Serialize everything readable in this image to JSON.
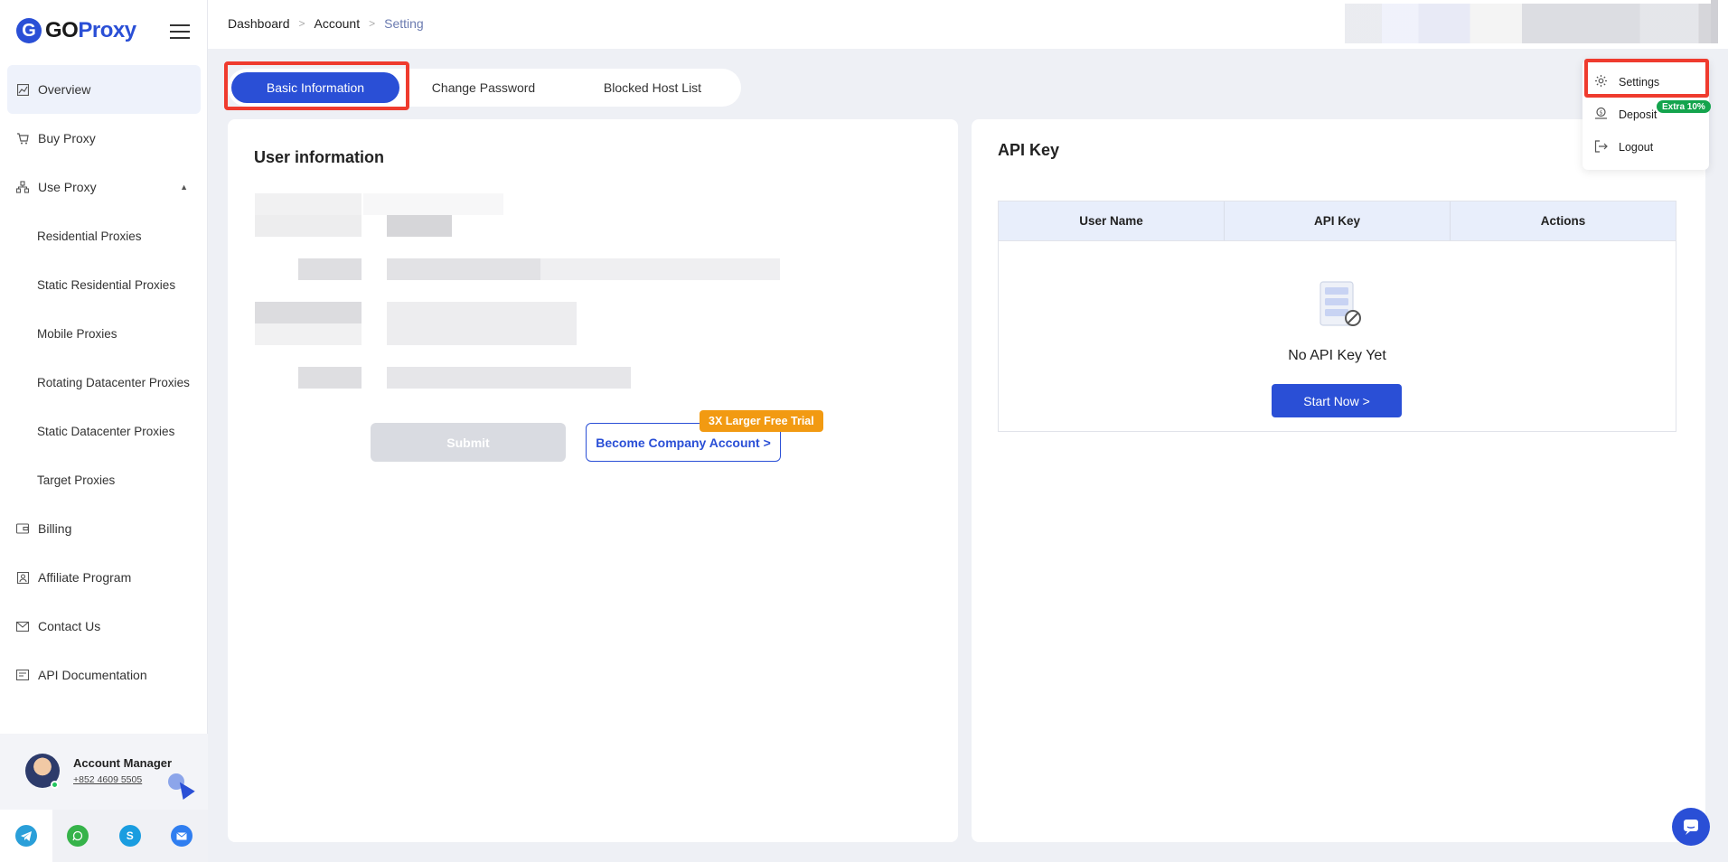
{
  "brand": {
    "logo_letter": "G",
    "name_part1": "GO",
    "name_part2": "Proxy",
    "color": "#2a4fd6"
  },
  "sidebar": {
    "items": [
      {
        "label": "Overview",
        "icon": "chart-icon",
        "active": true
      },
      {
        "label": "Buy Proxy",
        "icon": "cart-icon"
      },
      {
        "label": "Use Proxy",
        "icon": "network-icon",
        "expanded": true
      },
      {
        "label": "Residential Proxies",
        "sub": true
      },
      {
        "label": "Static Residential Proxies",
        "sub": true
      },
      {
        "label": "Mobile Proxies",
        "sub": true
      },
      {
        "label": "Rotating Datacenter Proxies",
        "sub": true
      },
      {
        "label": "Static Datacenter Proxies",
        "sub": true
      },
      {
        "label": "Target Proxies",
        "sub": true
      },
      {
        "label": "Billing",
        "icon": "wallet-icon"
      },
      {
        "label": "Affiliate Program",
        "icon": "affiliate-icon"
      },
      {
        "label": "Contact Us",
        "icon": "mail-icon"
      },
      {
        "label": "API Documentation",
        "icon": "api-doc-icon"
      }
    ],
    "account_manager": {
      "title": "Account Manager",
      "phone": "+852 4609 5505"
    },
    "social": [
      "telegram-icon",
      "whatsapp-icon",
      "skype-icon",
      "email-icon"
    ]
  },
  "header": {
    "breadcrumb": [
      "Dashboard",
      "Account",
      "Setting"
    ]
  },
  "tabs": [
    {
      "label": "Basic Information",
      "active": true
    },
    {
      "label": "Change Password"
    },
    {
      "label": "Blocked Host List"
    }
  ],
  "user_info": {
    "title": "User information",
    "submit_label": "Submit",
    "company_label": "Become Company Account >",
    "trial_badge": "3X Larger Free Trial"
  },
  "api_key": {
    "title": "API Key",
    "columns": [
      "User Name",
      "API Key",
      "Actions"
    ],
    "empty_text": "No API Key Yet",
    "start_label": "Start Now >"
  },
  "dropdown": {
    "items": [
      {
        "label": "Settings",
        "icon": "gear-icon"
      },
      {
        "label": "Deposit",
        "icon": "deposit-icon",
        "badge": "Extra 10%"
      },
      {
        "label": "Logout",
        "icon": "logout-icon"
      }
    ]
  },
  "colors": {
    "primary": "#2a4fd6",
    "highlight": "#ef3b2e",
    "trial": "#f29a12",
    "extra": "#14a44d"
  }
}
